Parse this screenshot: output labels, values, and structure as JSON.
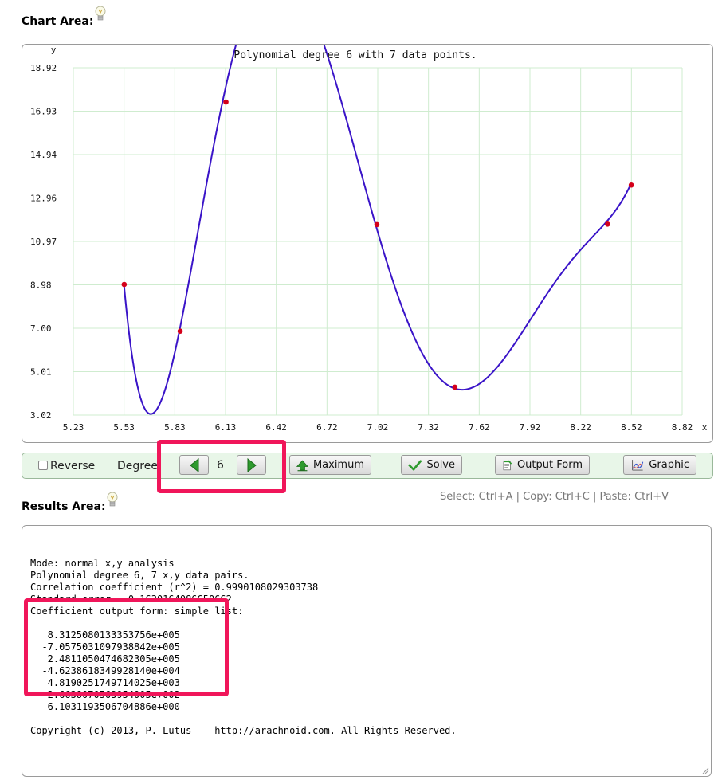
{
  "chart_section": {
    "title": "Chart Area:",
    "help_icon": "lightbulb-icon"
  },
  "chart_data": {
    "type": "line",
    "title": "Polynomial degree 6 with 7 data points.",
    "xlabel": "x",
    "ylabel": "y",
    "xlim": [
      5.23,
      8.82
    ],
    "ylim": [
      3.02,
      18.92
    ],
    "x_ticks": [
      "5.23",
      "5.53",
      "5.83",
      "6.13",
      "6.42",
      "6.72",
      "7.02",
      "7.32",
      "7.62",
      "7.92",
      "8.22",
      "8.52",
      "8.82"
    ],
    "y_ticks": [
      "3.02",
      "5.01",
      "7.00",
      "8.98",
      "10.97",
      "12.96",
      "14.94",
      "16.93",
      "18.92"
    ],
    "grid": true,
    "points": [
      {
        "x": 5.53,
        "y": 9.0
      },
      {
        "x": 5.86,
        "y": 6.86
      },
      {
        "x": 6.13,
        "y": 17.35
      },
      {
        "x": 7.02,
        "y": 11.74
      },
      {
        "x": 7.48,
        "y": 4.3
      },
      {
        "x": 8.38,
        "y": 11.76
      },
      {
        "x": 8.52,
        "y": 13.55
      }
    ],
    "fit_coefficients": [
      831250.8013335376,
      -705750.3109793884,
      248110.50474682305,
      -46238.61834992814,
      4819.0251749714025,
      -266.38070563954005,
      6.103119350670489
    ],
    "colors": {
      "curve": "#3a14c8",
      "points": "#d4001a",
      "grid": "#cfeccf"
    }
  },
  "controls": {
    "reverse_label": "Reverse",
    "degree_label": "Degree",
    "degree_value": "6",
    "prev_icon": "arrow-left-icon",
    "next_icon": "arrow-right-icon",
    "maximum_label": "Maximum",
    "solve_label": "Solve",
    "output_form_label": "Output Form",
    "graphic_label": "Graphic"
  },
  "results_section": {
    "title": "Results Area:",
    "hint": "Select: Ctrl+A | Copy: Ctrl+C | Paste: Ctrl+V",
    "lines": [
      "Mode: normal x,y analysis",
      "Polynomial degree 6, 7 x,y data pairs.",
      "Correlation coefficient (r^2) = 0.9990108029303738",
      "Standard error = 0.1630164086650662",
      "Coefficient output form: simple list:",
      "",
      "   8.3125080133353756e+005",
      "  -7.0575031097938842e+005",
      "   2.4811050474682305e+005",
      "  -4.6238618349928140e+004",
      "   4.8190251749714025e+003",
      "  -2.6638070563954005e+002",
      "   6.1031193506704886e+000",
      "",
      "Copyright (c) 2013, P. Lutus -- http://arachnoid.com. All Rights Reserved."
    ]
  },
  "highlight_color": "#f0165a"
}
